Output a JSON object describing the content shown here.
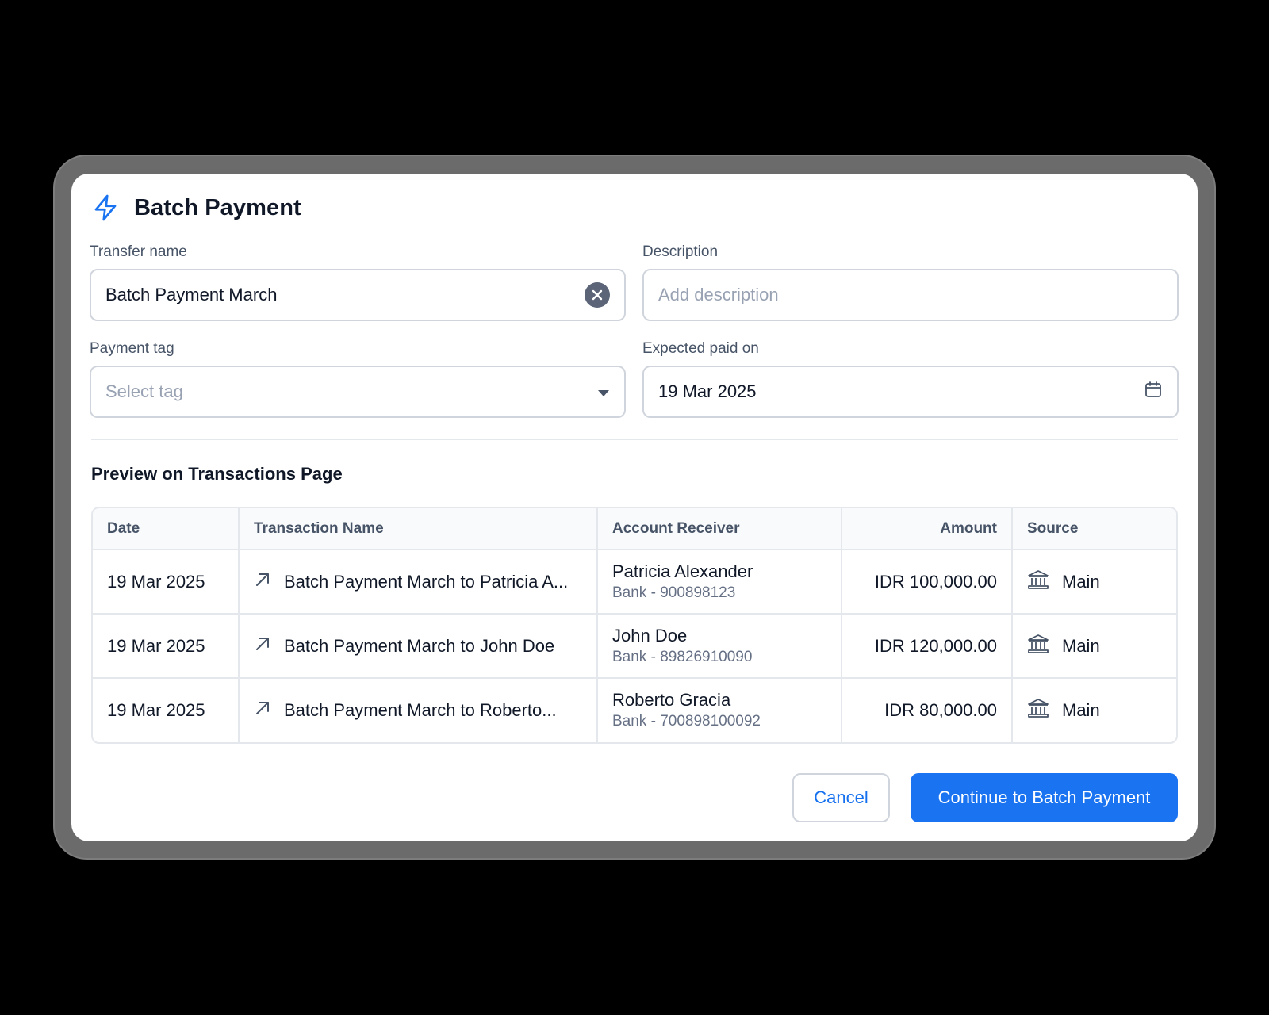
{
  "modal": {
    "title": "Batch Payment",
    "title_icon": "lightning-bolt-icon"
  },
  "form": {
    "transfer_name": {
      "label": "Transfer name",
      "value": "Batch Payment March"
    },
    "description": {
      "label": "Description",
      "placeholder": "Add description"
    },
    "payment_tag": {
      "label": "Payment tag",
      "placeholder": "Select tag"
    },
    "expected_paid_on": {
      "label": "Expected paid on",
      "value": "19 Mar 2025"
    }
  },
  "preview": {
    "title": "Preview on Transactions Page",
    "columns": [
      "Date",
      "Transaction Name",
      "Account Receiver",
      "Amount",
      "Source"
    ],
    "rows": [
      {
        "date": "19 Mar 2025",
        "name": "Batch Payment March to Patricia A...",
        "receiver": "Patricia Alexander",
        "receiver_sub": "Bank - 900898123",
        "amount": "IDR 100,000.00",
        "source": "Main"
      },
      {
        "date": "19 Mar 2025",
        "name": "Batch Payment March to John Doe",
        "receiver": "John Doe",
        "receiver_sub": "Bank - 89826910090",
        "amount": "IDR 120,000.00",
        "source": "Main"
      },
      {
        "date": "19 Mar 2025",
        "name": "Batch Payment March to Roberto...",
        "receiver": "Roberto Gracia",
        "receiver_sub": "Bank - 700898100092",
        "amount": "IDR 80,000.00",
        "source": "Main"
      }
    ]
  },
  "actions": {
    "cancel": "Cancel",
    "continue": "Continue to Batch Payment"
  },
  "colors": {
    "primary": "#1a73f0",
    "background": "#000000",
    "frame": "#6b6b6b"
  }
}
